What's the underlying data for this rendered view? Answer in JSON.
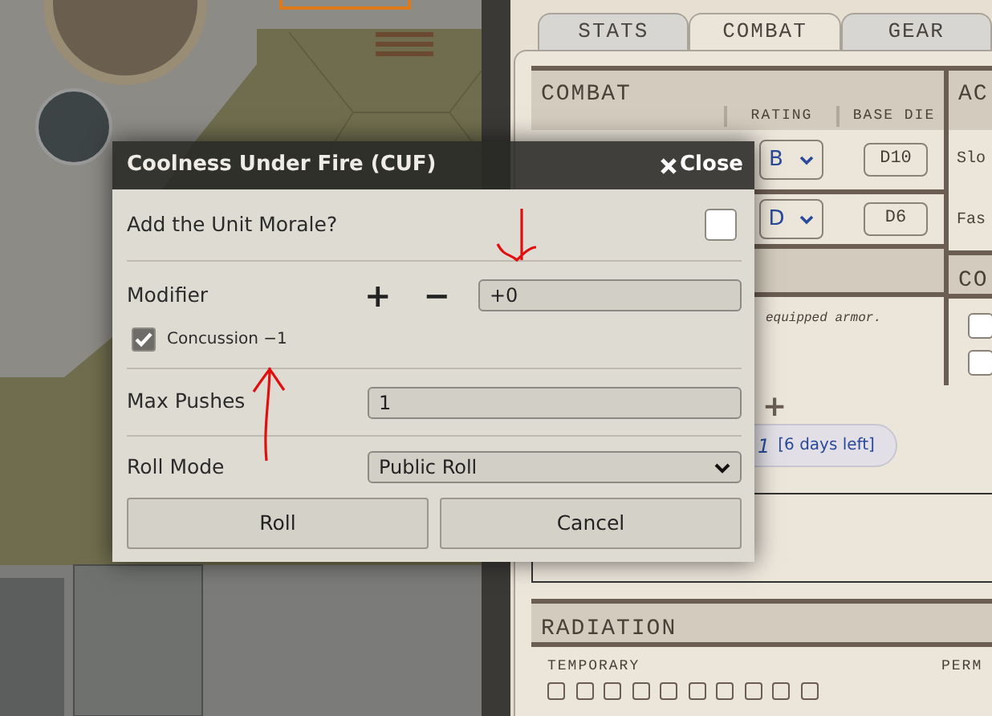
{
  "sheet": {
    "tabs": [
      {
        "label": "STATS",
        "selected": false
      },
      {
        "label": "COMBAT",
        "selected": true
      },
      {
        "label": "GEAR",
        "selected": false
      }
    ],
    "combat": {
      "title": "COMBAT",
      "columns": [
        "RATING",
        "BASE DIE"
      ],
      "rows": [
        {
          "rating": "B",
          "base_die": "D10"
        },
        {
          "rating": "D",
          "base_die": "D6"
        }
      ]
    },
    "side_panel": {
      "title": "AC",
      "rows": [
        "Slo",
        "Fas"
      ]
    },
    "section_2": {
      "title": "CO",
      "note": "equipped armor.",
      "checkboxes": [
        {
          "checked": false
        },
        {
          "checked": false
        }
      ]
    },
    "counter": {
      "button": "+",
      "value": "1",
      "remaining": "[6 days left]"
    },
    "radiation": {
      "title": "RADIATION",
      "temporary": {
        "label": "TEMPORARY",
        "boxes": [
          {
            "checked": false
          },
          {
            "checked": false
          },
          {
            "checked": false
          },
          {
            "checked": false
          },
          {
            "checked": false
          },
          {
            "checked": false
          },
          {
            "checked": false
          },
          {
            "checked": false
          },
          {
            "checked": false
          },
          {
            "checked": false
          }
        ]
      },
      "permanent": {
        "label": "PERM"
      }
    }
  },
  "dialog": {
    "title": "Coolness Under Fire (CUF)",
    "close": "Close",
    "add_morale": {
      "label": "Add the Unit Morale?",
      "checked": false
    },
    "modifier": {
      "label": "Modifier",
      "plus": "+",
      "minus": "−",
      "value": "+0"
    },
    "concussion": {
      "label": "Concussion −1",
      "checked": true
    },
    "max_pushes": {
      "label": "Max Pushes",
      "value": "1"
    },
    "roll_mode": {
      "label": "Roll Mode",
      "value": "Public Roll"
    },
    "buttons": [
      "Roll",
      "Cancel"
    ]
  }
}
